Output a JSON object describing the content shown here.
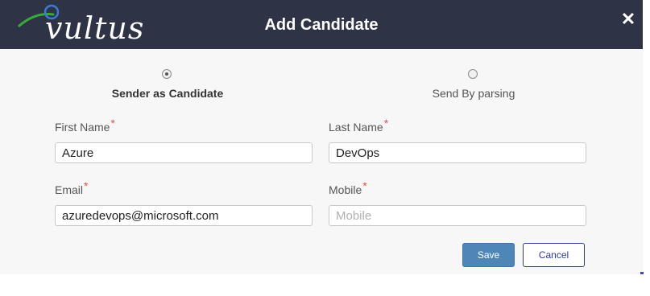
{
  "header": {
    "logo_text": "vultus",
    "title": "Add Candidate",
    "close_glyph": "✕"
  },
  "options": [
    {
      "label": "Sender as Candidate",
      "selected": true
    },
    {
      "label": "Send By parsing",
      "selected": false
    }
  ],
  "form": {
    "required_mark": "*",
    "first_name": {
      "label": "First Name",
      "value": "Azure"
    },
    "last_name": {
      "label": "Last Name",
      "value": "DevOps"
    },
    "email": {
      "label": "Email",
      "value": "azuredevops@microsoft.com"
    },
    "mobile": {
      "label": "Mobile",
      "value": "",
      "placeholder": "Mobile"
    }
  },
  "actions": {
    "save_label": "Save",
    "cancel_label": "Cancel"
  },
  "colors": {
    "header_bg": "#2e3446",
    "dialog_bg": "#f7f7f7",
    "save_bg": "#4f86b8",
    "cancel_border": "#2a3a9e",
    "required": "#d9534f",
    "logo_green": "#3aa83a",
    "logo_blue": "#3a7bd5"
  }
}
